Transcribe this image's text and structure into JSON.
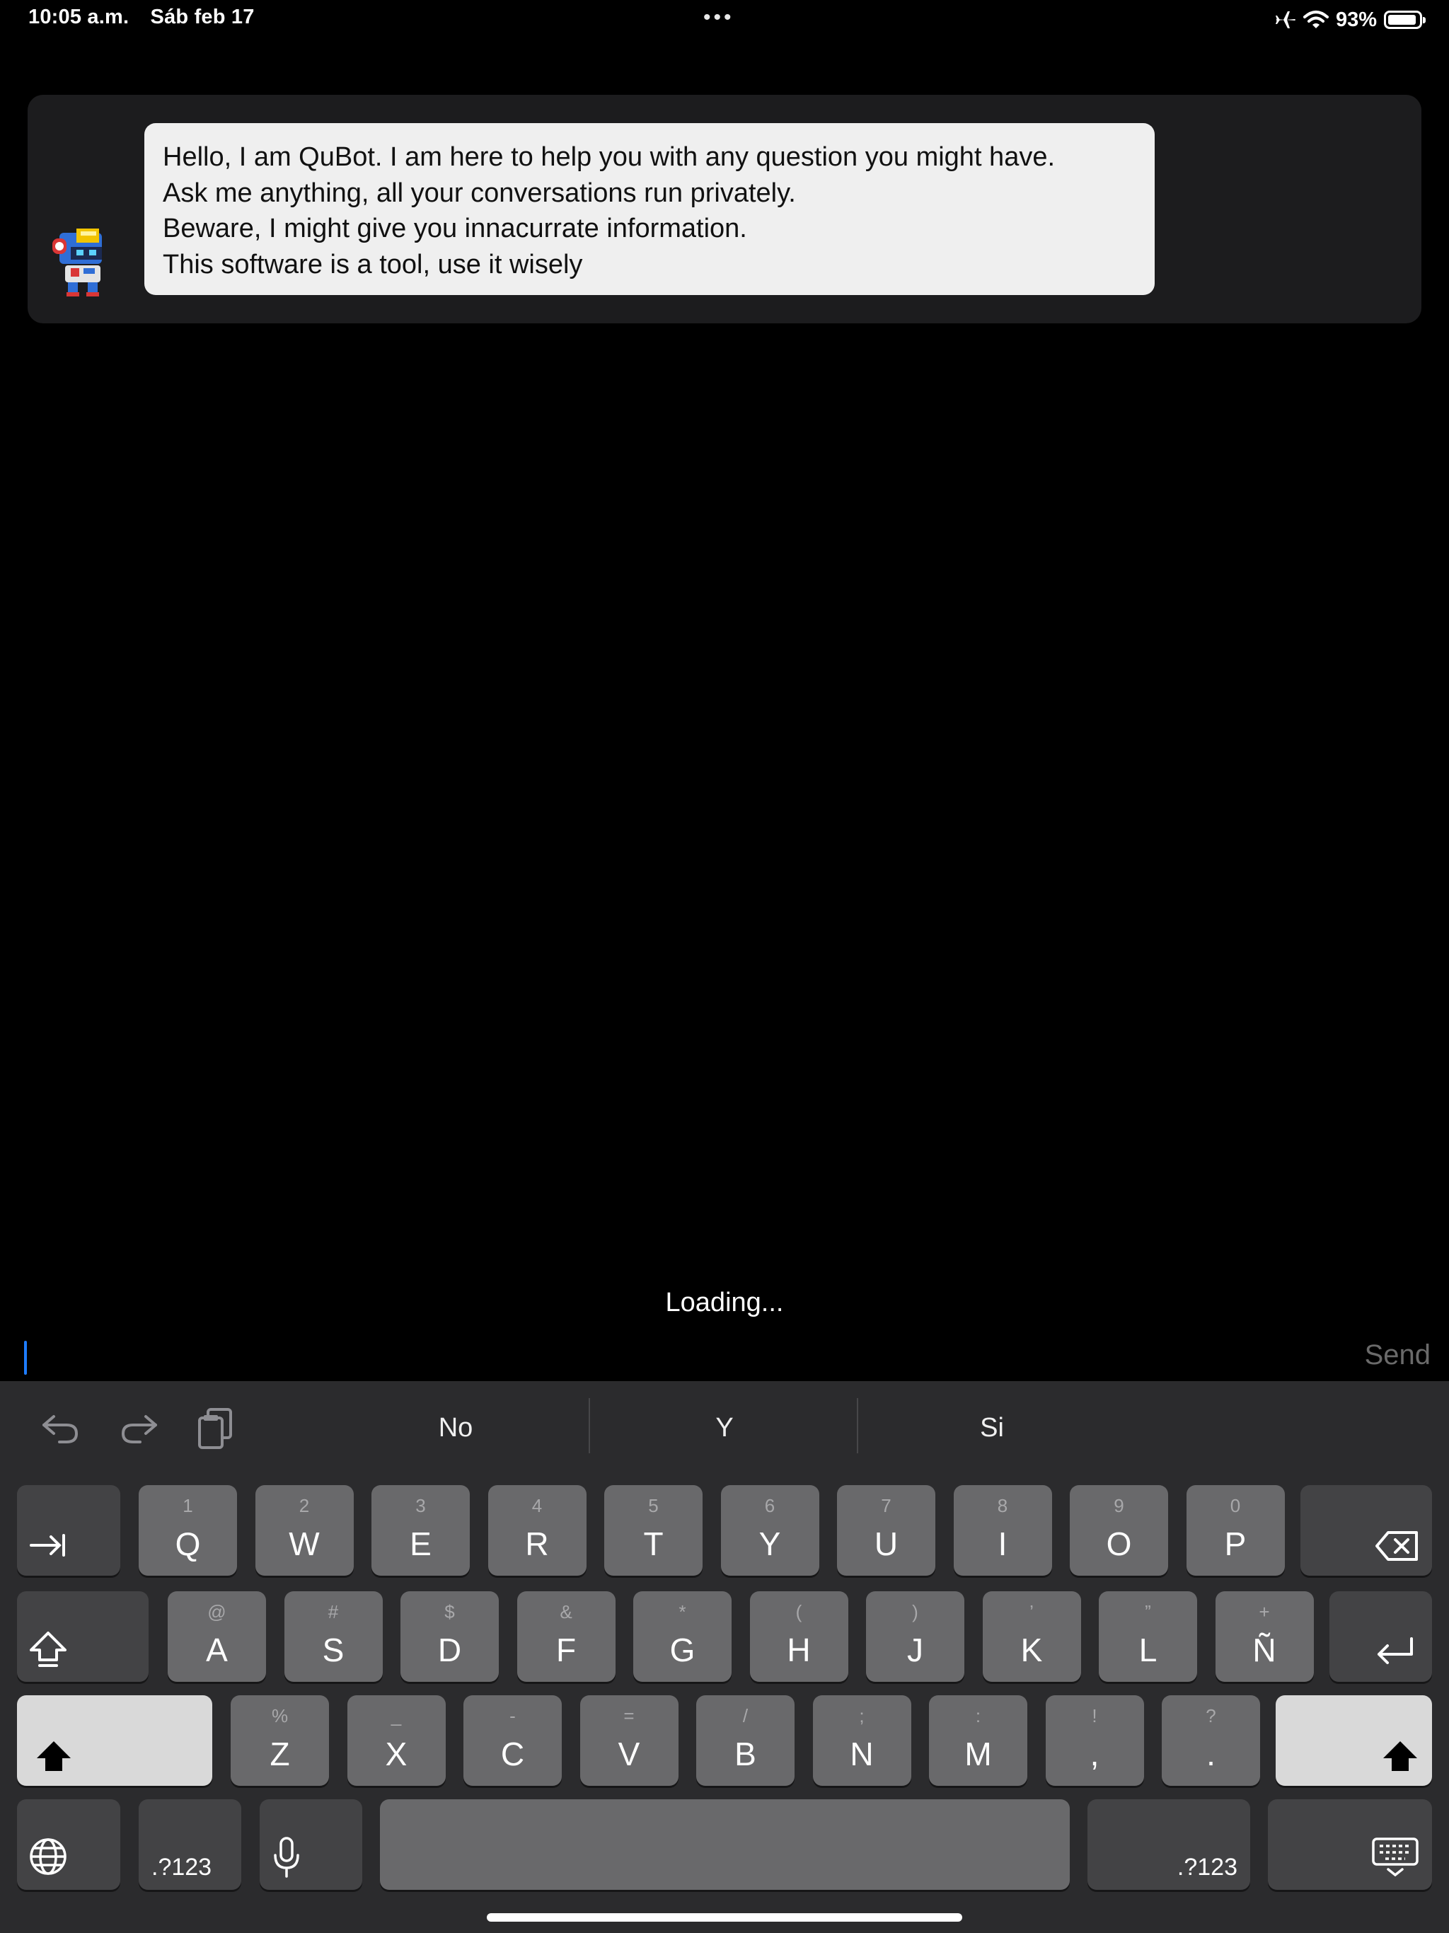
{
  "status_bar": {
    "time": "10:05 a.m.",
    "date": "Sáb feb 17",
    "battery_percent": "93%",
    "battery_level": 0.93
  },
  "chat": {
    "bot_name": "QuBot",
    "message_lines": [
      "Hello, I am QuBot. I am here to help you with any question you might have.",
      "Ask me anything, all your conversations run privately.",
      "Beware, I might give you innacurrate information.",
      "This software is a tool, use it wisely"
    ]
  },
  "loading_text": "Loading...",
  "input": {
    "value": "",
    "send_label": "Send"
  },
  "keyboard": {
    "suggestions": [
      "No",
      "Y",
      "Si"
    ],
    "row1": [
      {
        "main": "Q",
        "sub": "1"
      },
      {
        "main": "W",
        "sub": "2"
      },
      {
        "main": "E",
        "sub": "3"
      },
      {
        "main": "R",
        "sub": "4"
      },
      {
        "main": "T",
        "sub": "5"
      },
      {
        "main": "Y",
        "sub": "6"
      },
      {
        "main": "U",
        "sub": "7"
      },
      {
        "main": "I",
        "sub": "8"
      },
      {
        "main": "O",
        "sub": "9"
      },
      {
        "main": "P",
        "sub": "0"
      }
    ],
    "row2": [
      {
        "main": "A",
        "sub": "@"
      },
      {
        "main": "S",
        "sub": "#"
      },
      {
        "main": "D",
        "sub": "$"
      },
      {
        "main": "F",
        "sub": "&"
      },
      {
        "main": "G",
        "sub": "*"
      },
      {
        "main": "H",
        "sub": "("
      },
      {
        "main": "J",
        "sub": ")"
      },
      {
        "main": "K",
        "sub": "’"
      },
      {
        "main": "L",
        "sub": "”"
      },
      {
        "main": "Ñ",
        "sub": "+"
      }
    ],
    "row3": [
      {
        "main": "Z",
        "sub": "%"
      },
      {
        "main": "X",
        "sub": "_"
      },
      {
        "main": "C",
        "sub": "-"
      },
      {
        "main": "V",
        "sub": "="
      },
      {
        "main": "B",
        "sub": "/"
      },
      {
        "main": "N",
        "sub": ";"
      },
      {
        "main": "M",
        "sub": ":"
      },
      {
        "main": ",",
        "sub": "!"
      },
      {
        "main": ".",
        "sub": "?"
      }
    ],
    "numbers_label": ".?123"
  }
}
